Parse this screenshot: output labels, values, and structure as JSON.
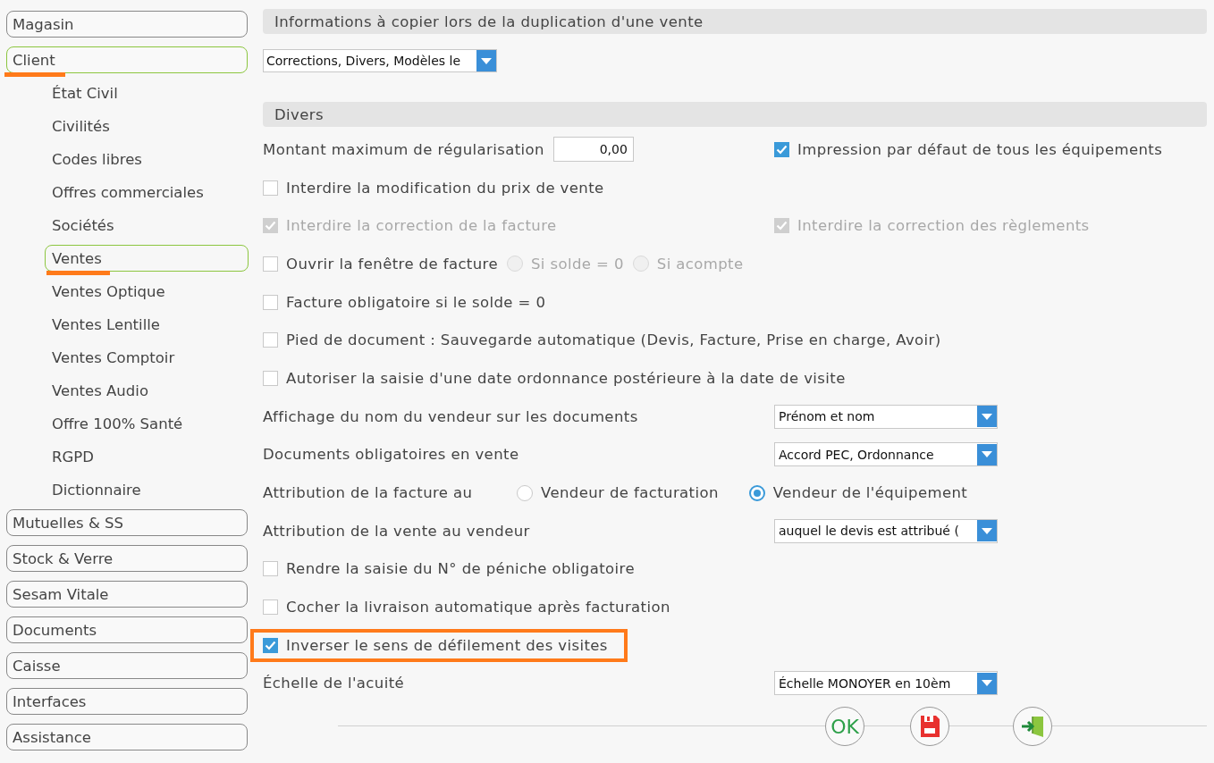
{
  "sidebar": {
    "items": [
      {
        "label": "Magasin",
        "kind": "group",
        "selected": false,
        "highlighted": false
      },
      {
        "label": "Client",
        "kind": "group",
        "selected": true,
        "highlighted": true
      },
      {
        "label": "État Civil",
        "kind": "sub",
        "selected": false,
        "highlighted": false
      },
      {
        "label": "Civilités",
        "kind": "sub",
        "selected": false,
        "highlighted": false
      },
      {
        "label": "Codes libres",
        "kind": "sub",
        "selected": false,
        "highlighted": false
      },
      {
        "label": "Offres commerciales",
        "kind": "sub",
        "selected": false,
        "highlighted": false
      },
      {
        "label": "Sociétés",
        "kind": "sub",
        "selected": false,
        "highlighted": false
      },
      {
        "label": "Ventes",
        "kind": "sub",
        "selected": true,
        "highlighted": true
      },
      {
        "label": "Ventes Optique",
        "kind": "sub",
        "selected": false,
        "highlighted": false
      },
      {
        "label": "Ventes Lentille",
        "kind": "sub",
        "selected": false,
        "highlighted": false
      },
      {
        "label": "Ventes Comptoir",
        "kind": "sub",
        "selected": false,
        "highlighted": false
      },
      {
        "label": "Ventes Audio",
        "kind": "sub",
        "selected": false,
        "highlighted": false
      },
      {
        "label": "Offre 100% Santé",
        "kind": "sub",
        "selected": false,
        "highlighted": false
      },
      {
        "label": "RGPD",
        "kind": "sub",
        "selected": false,
        "highlighted": false
      },
      {
        "label": "Dictionnaire",
        "kind": "sub",
        "selected": false,
        "highlighted": false
      },
      {
        "label": "Mutuelles & SS",
        "kind": "group",
        "selected": false,
        "highlighted": false
      },
      {
        "label": "Stock & Verre",
        "kind": "group",
        "selected": false,
        "highlighted": false
      },
      {
        "label": "Sesam Vitale",
        "kind": "group",
        "selected": false,
        "highlighted": false
      },
      {
        "label": "Documents",
        "kind": "group",
        "selected": false,
        "highlighted": false
      },
      {
        "label": "Caisse",
        "kind": "group",
        "selected": false,
        "highlighted": false
      },
      {
        "label": "Interfaces",
        "kind": "group",
        "selected": false,
        "highlighted": false
      },
      {
        "label": "Assistance",
        "kind": "group",
        "selected": false,
        "highlighted": false
      }
    ]
  },
  "sections": [
    {
      "title": "Informations à copier lors de la duplication d'une vente",
      "rows": [
        {
          "kind": "dropdown",
          "value": "Corrections, Divers, Modèles le"
        }
      ]
    },
    {
      "title": "Divers",
      "rows": [
        {
          "kind": "amount",
          "label": "Montant maximum de régularisation",
          "value": "0,00",
          "side": {
            "label": "Impression par défaut de tous les équipements",
            "checked": true,
            "disabled": false
          }
        },
        {
          "kind": "checkbox",
          "label": "Interdire la modification du prix de vente",
          "checked": false,
          "disabled": false,
          "highlighted": false
        },
        {
          "kind": "checkbox",
          "label": "Interdire la correction de la facture",
          "checked": true,
          "disabled": true,
          "highlighted": false,
          "side": {
            "label": "Interdire la correction des règlements",
            "checked": true,
            "disabled": true
          }
        },
        {
          "kind": "checkbox",
          "label": "Ouvrir la fenêtre de facture",
          "checked": false,
          "disabled": false,
          "highlighted": false,
          "options": [
            {
              "label": "Si solde = 0",
              "selected": false,
              "disabled": true
            },
            {
              "label": "Si acompte",
              "selected": false,
              "disabled": true
            }
          ]
        },
        {
          "kind": "checkbox",
          "label": "Facture obligatoire si le solde = 0",
          "checked": false,
          "disabled": false,
          "highlighted": false
        },
        {
          "kind": "checkbox",
          "label": "Pied de document : Sauvegarde automatique (Devis, Facture, Prise en charge, Avoir)",
          "checked": false,
          "disabled": false,
          "highlighted": false
        },
        {
          "kind": "checkbox",
          "label": "Autoriser la saisie d'une date ordonnance postérieure à la date de visite",
          "checked": false,
          "disabled": false,
          "highlighted": false
        },
        {
          "kind": "select",
          "label": "Affichage du nom du vendeur sur les documents",
          "value": "Prénom et nom"
        },
        {
          "kind": "select",
          "label": "Documents obligatoires en vente",
          "value": "Accord PEC, Ordonnance"
        },
        {
          "kind": "radio",
          "label": "Attribution de la facture au",
          "options": [
            {
              "label": "Vendeur de facturation",
              "selected": false,
              "disabled": false
            },
            {
              "label": "Vendeur de l'équipement",
              "selected": true,
              "disabled": false
            }
          ]
        },
        {
          "kind": "select",
          "label": "Attribution de la vente au vendeur",
          "value": "auquel le devis est attribué ("
        },
        {
          "kind": "checkbox",
          "label": "Rendre la saisie du N° de péniche obligatoire",
          "checked": false,
          "disabled": false,
          "highlighted": false
        },
        {
          "kind": "checkbox",
          "label": "Cocher la livraison automatique après facturation",
          "checked": false,
          "disabled": false,
          "highlighted": false
        },
        {
          "kind": "checkbox",
          "label": "Inverser le sens de défilement des visites",
          "checked": true,
          "disabled": false,
          "highlighted": true
        },
        {
          "kind": "select",
          "label": "Échelle de l'acuité",
          "value": "Échelle MONOYER en 10èm"
        }
      ]
    }
  ],
  "actions": [
    {
      "kind": "ok",
      "label": "OK"
    },
    {
      "kind": "save"
    },
    {
      "kind": "exit"
    }
  ]
}
